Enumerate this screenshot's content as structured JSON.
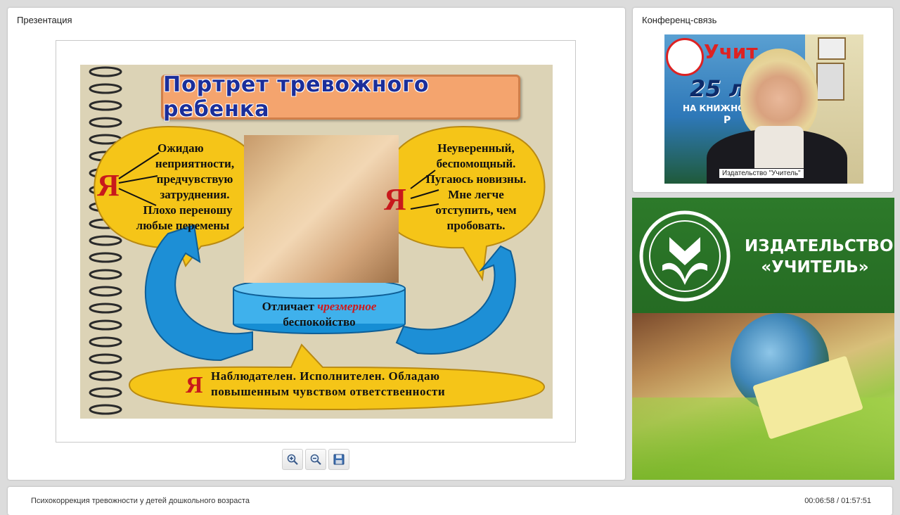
{
  "presentation": {
    "title": "Презентация",
    "slide": {
      "heading": "Портрет тревожного ребенка",
      "left_bubble": {
        "pronoun": "Я",
        "lines": [
          "Ожидаю",
          "неприятности,",
          "предчувствую",
          "затруднения.",
          "Плохо переношу",
          "любые перемены"
        ]
      },
      "right_bubble": {
        "pronoun": "Я",
        "lines": [
          "Неуверенный,",
          "беспомощный.",
          "Пугаюсь новизны.",
          "Мне легче",
          "отступить, чем",
          "пробовать."
        ]
      },
      "center": {
        "prefix": "Отличает",
        "highlight": "чрезмерное",
        "suffix": "беспокойство"
      },
      "bottom": {
        "pronoun": "Я",
        "line1": "Наблюдателен. Исполнителен. Обладаю",
        "line2": "повышенным чувством ответственности"
      }
    },
    "toolbar": [
      {
        "name": "zoom-in-button",
        "icon": "zoom-in-icon"
      },
      {
        "name": "zoom-out-button",
        "icon": "zoom-out-icon"
      },
      {
        "name": "save-button",
        "icon": "floppy-disk-icon"
      }
    ]
  },
  "conference": {
    "title": "Конференц-связь",
    "video_label": "Издательство \"Учитель\"",
    "banner_text": {
      "brand": "Учит",
      "line1": "25 л",
      "line2": "НА КНИЖНО",
      "line3": "Р"
    }
  },
  "publisher": {
    "line1": "ИЗДАТЕЛЬСТВО",
    "line2": "«УЧИТЕЛЬ»"
  },
  "footer": {
    "title": "Психокоррекция тревожности у детей дошкольного возраста",
    "time": "00:06:58 / 01:57:51"
  },
  "colors": {
    "heading_text": "#1b2e9a",
    "bubble_yellow": "#f5c518",
    "arrow_blue": "#1d8fd6",
    "accent_red": "#c8191c",
    "publisher_green": "#2d7a2a"
  }
}
